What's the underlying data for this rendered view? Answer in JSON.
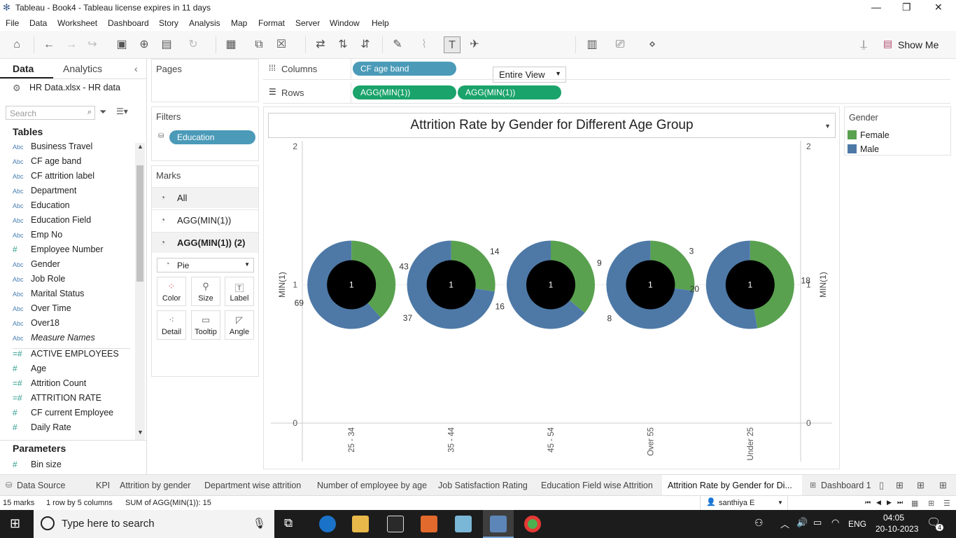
{
  "window": {
    "title": "Tableau - Book4 - Tableau license expires in 11 days"
  },
  "menu": [
    "File",
    "Data",
    "Worksheet",
    "Dashboard",
    "Story",
    "Analysis",
    "Map",
    "Format",
    "Server",
    "Window",
    "Help"
  ],
  "toolbar": {
    "fit": "Entire View",
    "show_me": "Show Me"
  },
  "data_pane": {
    "tab_data": "Data",
    "tab_analytics": "Analytics",
    "datasource": "HR Data.xlsx - HR data",
    "search_placeholder": "Search",
    "tables_header": "Tables",
    "dimensions": [
      {
        "type": "Abc",
        "name": "Business Travel"
      },
      {
        "type": "Abc",
        "name": "CF age band"
      },
      {
        "type": "Abc",
        "name": "CF attrition label"
      },
      {
        "type": "Abc",
        "name": "Department"
      },
      {
        "type": "Abc",
        "name": "Education"
      },
      {
        "type": "Abc",
        "name": "Education Field"
      },
      {
        "type": "Abc",
        "name": "Emp No"
      },
      {
        "type": "#",
        "name": "Employee Number"
      },
      {
        "type": "Abc",
        "name": "Gender"
      },
      {
        "type": "Abc",
        "name": "Job Role"
      },
      {
        "type": "Abc",
        "name": "Marital Status"
      },
      {
        "type": "Abc",
        "name": "Over Time"
      },
      {
        "type": "Abc",
        "name": "Over18"
      },
      {
        "type": "Abc",
        "name": "Measure Names"
      }
    ],
    "measures": [
      {
        "type": "=#",
        "name": "ACTIVE EMPLOYEES"
      },
      {
        "type": "#",
        "name": "Age"
      },
      {
        "type": "=#",
        "name": "Attrition Count"
      },
      {
        "type": "=#",
        "name": "ATTRITION RATE"
      },
      {
        "type": "#",
        "name": "CF current Employee"
      },
      {
        "type": "#",
        "name": "Daily Rate"
      }
    ],
    "parameters_header": "Parameters",
    "parameters": [
      {
        "type": "#",
        "name": "Bin size"
      }
    ]
  },
  "pages_card": {
    "title": "Pages"
  },
  "filters_card": {
    "title": "Filters",
    "pill": "Education"
  },
  "marks_card": {
    "title": "Marks",
    "rows": [
      "All",
      "AGG(MIN(1))",
      "AGG(MIN(1)) (2)"
    ],
    "mark_type": "Pie",
    "buttons": [
      "Color",
      "Size",
      "Label",
      "Detail",
      "Tooltip",
      "Angle"
    ]
  },
  "shelves": {
    "columns_label": "Columns",
    "columns_pill": "CF age band",
    "rows_label": "Rows",
    "rows_pills": [
      "AGG(MIN(1))",
      "AGG(MIN(1))"
    ]
  },
  "chart": {
    "title": "Attrition Rate by Gender for Different Age Group",
    "axis_label": "MIN(1)",
    "ticks": [
      "2",
      "1",
      "0"
    ],
    "center_label": "1"
  },
  "chart_data": {
    "type": "pie",
    "title": "Attrition Rate by Gender for Different Age Group",
    "categories": [
      "25 - 34",
      "35 - 44",
      "45 - 54",
      "Over 55",
      "Under 25"
    ],
    "series": [
      {
        "name": "Female",
        "values": [
          43,
          14,
          9,
          3,
          18
        ]
      },
      {
        "name": "Male",
        "values": [
          69,
          37,
          16,
          8,
          20
        ]
      }
    ],
    "colors": {
      "Female": "#59a14f",
      "Male": "#4e79a7"
    },
    "ylabel": "MIN(1)",
    "ylim": [
      0,
      2
    ]
  },
  "legend": {
    "title": "Gender",
    "items": [
      {
        "label": "Female",
        "color": "#59a14f"
      },
      {
        "label": "Male",
        "color": "#4e79a7"
      }
    ]
  },
  "sheet_tabs": [
    "Data Source",
    "KPI",
    "Attrition by gender",
    "Department wise attrition",
    "Number of employee by age",
    "Job Satisfaction Rating",
    "Education Field wise Attrition",
    "Attrition Rate by Gender for Di...",
    "Dashboard 1"
  ],
  "status": {
    "marks": "15 marks",
    "rows": "1 row by 5 columns",
    "sum": "SUM of AGG(MIN(1)): 15",
    "user": "santhiya E"
  },
  "taskbar": {
    "search": "Type here to search",
    "lang": "ENG",
    "time": "04:05",
    "date": "20-10-2023",
    "notif": "4"
  }
}
